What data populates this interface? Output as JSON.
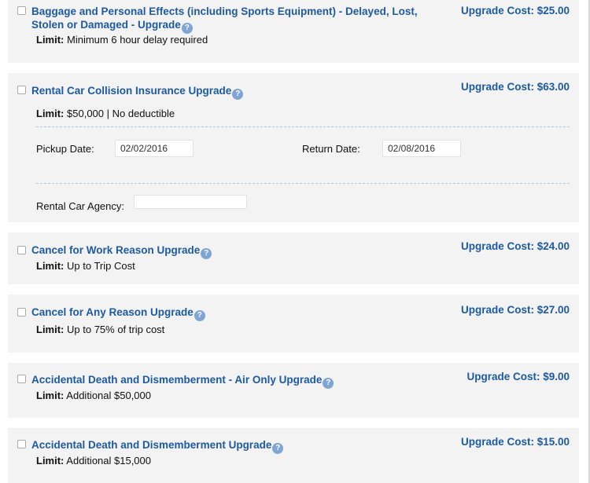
{
  "upgrades": [
    {
      "title_line1": "Baggage and Personal Effects (including Sports Equipment) - Delayed, Lost,",
      "title_line2": "Stolen or Damaged - Upgrade",
      "cost": "Upgrade Cost: $25.00",
      "limit_label": "Limit:",
      "limit_value": "Minimum 6 hour delay required"
    },
    {
      "title": "Rental Car Collision Insurance Upgrade",
      "cost": "Upgrade Cost: $63.00",
      "limit_label": "Limit:",
      "limit_value": "$50,000 | No deductible",
      "pickup_label": "Pickup Date:",
      "pickup_value": "02/02/2016",
      "return_label": "Return Date:",
      "return_value": "02/08/2016",
      "agency_label": "Rental Car Agency:",
      "agency_value": ""
    },
    {
      "title": "Cancel for Work Reason Upgrade",
      "cost": "Upgrade Cost: $24.00",
      "limit_label": "Limit:",
      "limit_value": "Up to Trip Cost"
    },
    {
      "title": "Cancel for Any Reason Upgrade",
      "cost": "Upgrade Cost: $27.00",
      "limit_label": "Limit:",
      "limit_value": "Up to 75% of trip cost"
    },
    {
      "title": "Accidental Death and Dismemberment - Air Only Upgrade",
      "cost": "Upgrade Cost: $9.00",
      "limit_label": "Limit:",
      "limit_value": "Additional $50,000"
    },
    {
      "title": "Accidental Death and Dismemberment Upgrade",
      "cost": "Upgrade Cost: $15.00",
      "limit_label": "Limit:",
      "limit_value": "Additional $15,000"
    }
  ],
  "help_glyph": "?",
  "colors": {
    "link": "#1d5aa3",
    "panel": "#f3f3f3",
    "help": "#7ea5d4",
    "dash": "#a7cbe0"
  }
}
